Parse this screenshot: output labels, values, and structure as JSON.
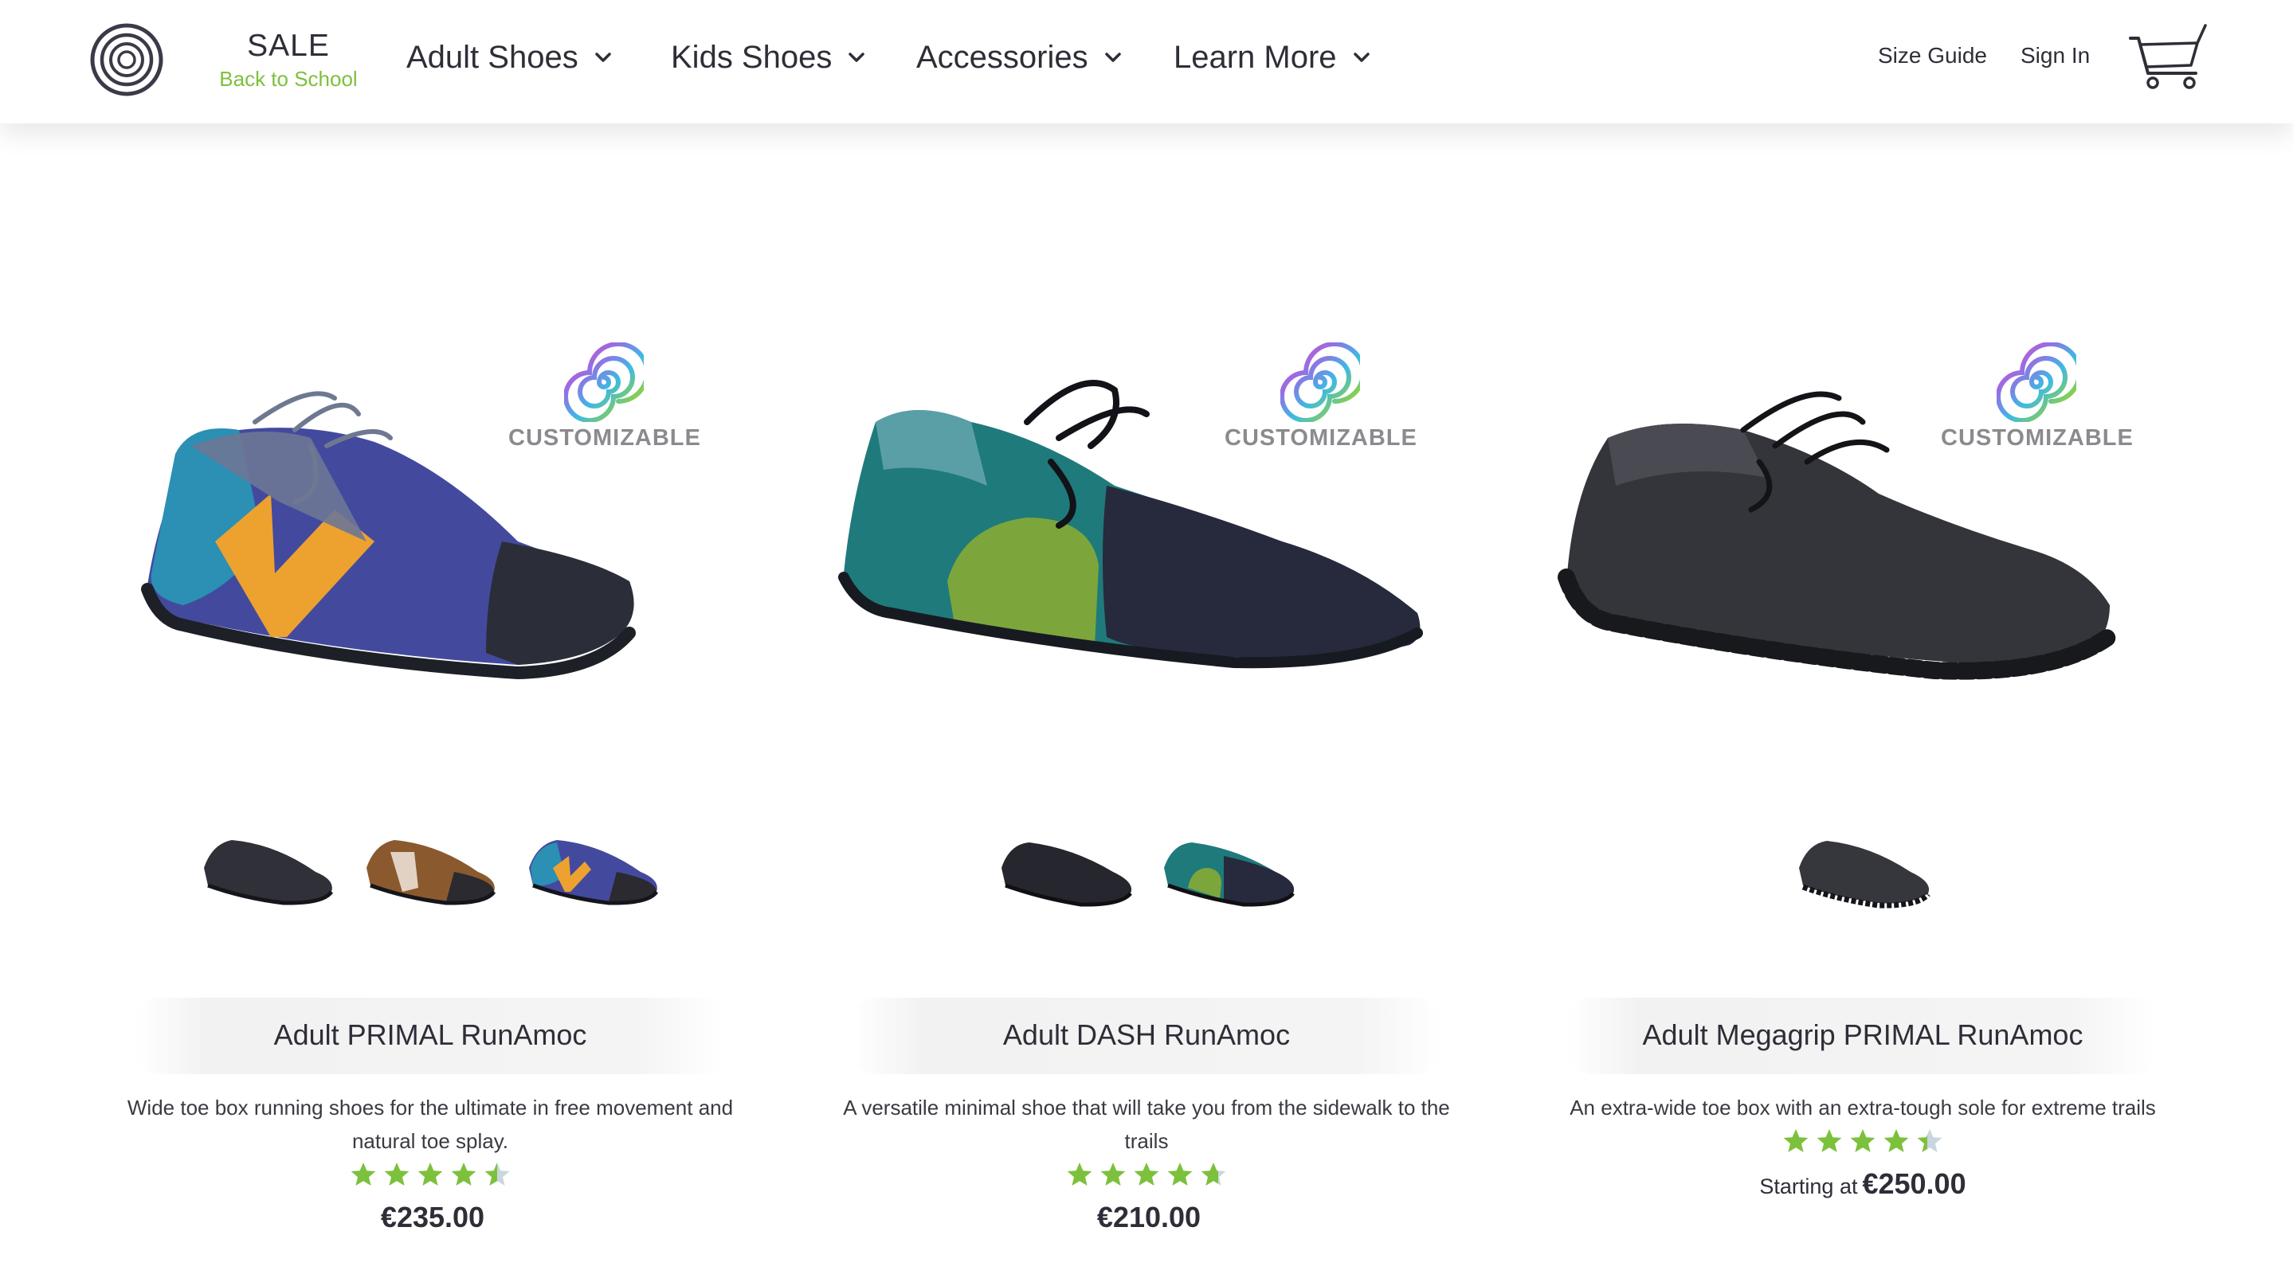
{
  "header": {
    "sale": {
      "title": "SALE",
      "subtitle": "Back to School"
    },
    "nav": [
      "Adult Shoes",
      "Kids Shoes",
      "Accessories",
      "Learn More"
    ],
    "links": {
      "size_guide": "Size Guide",
      "sign_in": "Sign In"
    }
  },
  "products": [
    {
      "badge": "CUSTOMIZABLE",
      "name": "Adult PRIMAL RunAmoc",
      "description": "Wide toe box running shoes for the ultimate in free movement and natural toe splay.",
      "rating": 4.5,
      "price": "€235.00",
      "price_prefix": ""
    },
    {
      "badge": "CUSTOMIZABLE",
      "name": "Adult DASH RunAmoc",
      "description": "A versatile minimal shoe that will take you from the sidewalk to the trails",
      "rating": 4.7,
      "price": "€210.00",
      "price_prefix": ""
    },
    {
      "badge": "CUSTOMIZABLE",
      "name": "Adult Megagrip PRIMAL RunAmoc",
      "description": "An extra-wide toe box with an extra-tough sole for extreme trails",
      "rating": 4.4,
      "price": "€250.00",
      "price_prefix": "Starting at"
    }
  ],
  "colors": {
    "accent_green": "#7cc13c",
    "text_dark": "#2e2e38",
    "star_empty": "#c9d6df"
  }
}
